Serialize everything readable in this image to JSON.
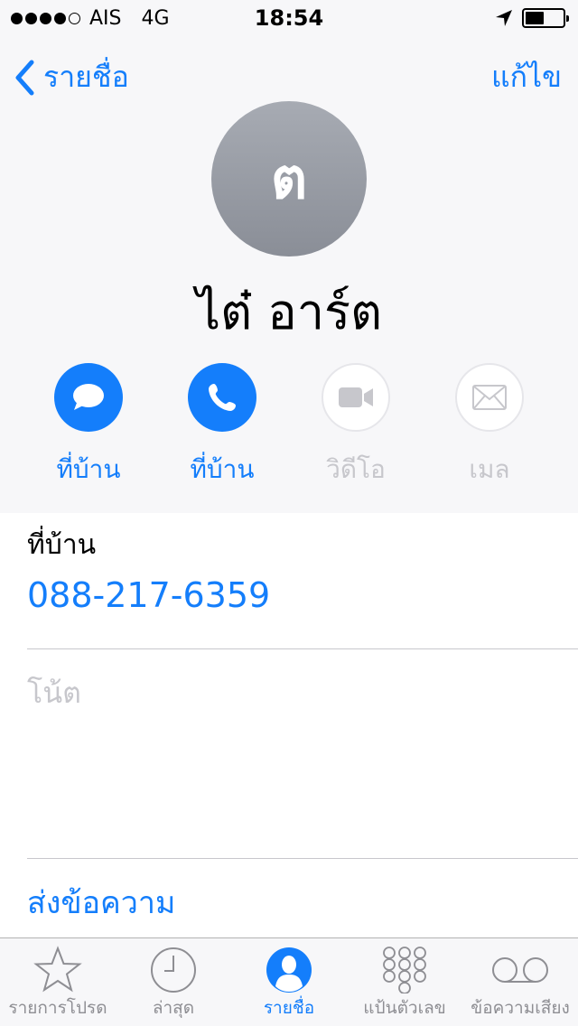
{
  "status_bar": {
    "carrier": "AIS",
    "network": "4G",
    "time": "18:54",
    "signal_icon": "signal-dots-icon",
    "location_icon": "location-arrow-icon",
    "battery_icon": "battery-icon"
  },
  "nav": {
    "back_label": "รายชื่อ",
    "edit_label": "แก้ไข"
  },
  "contact": {
    "avatar_initial": "ต",
    "name": "ไต๋ อาร์ต"
  },
  "actions": [
    {
      "label": "ที่บ้าน",
      "icon": "message-icon",
      "enabled": true
    },
    {
      "label": "ที่บ้าน",
      "icon": "phone-icon",
      "enabled": true
    },
    {
      "label": "วิดีโอ",
      "icon": "video-icon",
      "enabled": false
    },
    {
      "label": "เมล",
      "icon": "mail-icon",
      "enabled": false
    }
  ],
  "phone": {
    "label": "ที่บ้าน",
    "number": "088-217-6359"
  },
  "notes": {
    "label": "โน้ต"
  },
  "send_message": {
    "label": "ส่งข้อความ"
  },
  "tabs": [
    {
      "label": "รายการโปรด",
      "icon": "star-icon",
      "active": false
    },
    {
      "label": "ล่าสุด",
      "icon": "clock-icon",
      "active": false
    },
    {
      "label": "รายชื่อ",
      "icon": "contacts-icon",
      "active": true
    },
    {
      "label": "แป้นตัวเลข",
      "icon": "keypad-icon",
      "active": false
    },
    {
      "label": "ข้อความเสียง",
      "icon": "voicemail-icon",
      "active": false
    }
  ],
  "colors": {
    "accent": "#147efb",
    "disabled": "#c7c7cc",
    "header_bg": "#f7f7f9"
  }
}
